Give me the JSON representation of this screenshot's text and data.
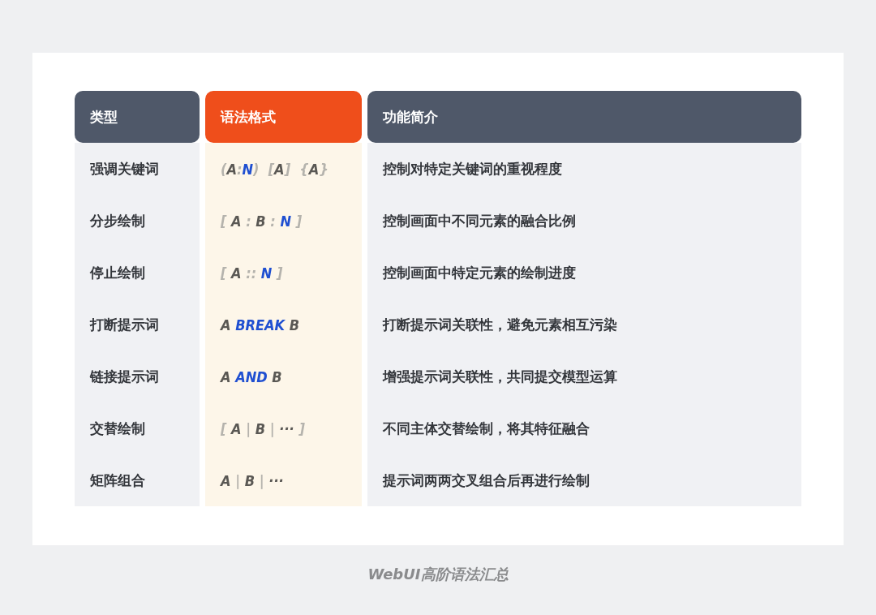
{
  "table": {
    "columns": [
      {
        "label": "类型",
        "kind": "plain"
      },
      {
        "label": "语法格式",
        "kind": "accent"
      },
      {
        "label": "功能简介",
        "kind": "plain"
      }
    ],
    "rows": [
      {
        "type": "强调关键词",
        "syntax": [
          {
            "text": "(",
            "kind": "punct"
          },
          {
            "text": "A",
            "kind": "var"
          },
          {
            "text": ":",
            "kind": "punct"
          },
          {
            "text": "N",
            "kind": "keyword"
          },
          {
            "text": ")  [",
            "kind": "punct"
          },
          {
            "text": "A",
            "kind": "var"
          },
          {
            "text": "]  {",
            "kind": "punct"
          },
          {
            "text": "A",
            "kind": "var"
          },
          {
            "text": "}",
            "kind": "punct"
          }
        ],
        "description": "控制对特定关键词的重视程度"
      },
      {
        "type": "分步绘制",
        "syntax": [
          {
            "text": "[ ",
            "kind": "punct"
          },
          {
            "text": "A",
            "kind": "var"
          },
          {
            "text": " : ",
            "kind": "punct"
          },
          {
            "text": "B",
            "kind": "var"
          },
          {
            "text": " : ",
            "kind": "punct"
          },
          {
            "text": "N",
            "kind": "keyword"
          },
          {
            "text": " ]",
            "kind": "punct"
          }
        ],
        "description": "控制画面中不同元素的融合比例"
      },
      {
        "type": "停止绘制",
        "syntax": [
          {
            "text": "[ ",
            "kind": "punct"
          },
          {
            "text": "A",
            "kind": "var"
          },
          {
            "text": " :: ",
            "kind": "punct"
          },
          {
            "text": "N",
            "kind": "keyword"
          },
          {
            "text": " ]",
            "kind": "punct"
          }
        ],
        "description": "控制画面中特定元素的绘制进度"
      },
      {
        "type": "打断提示词",
        "syntax": [
          {
            "text": "A ",
            "kind": "var"
          },
          {
            "text": "BREAK",
            "kind": "keyword"
          },
          {
            "text": " B",
            "kind": "var"
          }
        ],
        "description": "打断提示词关联性，避免元素相互污染"
      },
      {
        "type": "链接提示词",
        "syntax": [
          {
            "text": "A ",
            "kind": "var"
          },
          {
            "text": "AND",
            "kind": "keyword"
          },
          {
            "text": " B",
            "kind": "var"
          }
        ],
        "description": "增强提示词关联性，共同提交模型运算"
      },
      {
        "type": "交替绘制",
        "syntax": [
          {
            "text": "[ ",
            "kind": "punct"
          },
          {
            "text": "A",
            "kind": "var"
          },
          {
            "text": " | ",
            "kind": "punct"
          },
          {
            "text": "B",
            "kind": "var"
          },
          {
            "text": " | ",
            "kind": "punct"
          },
          {
            "text": "···",
            "kind": "var"
          },
          {
            "text": " ]",
            "kind": "punct"
          }
        ],
        "description": "不同主体交替绘制，将其特征融合"
      },
      {
        "type": "矩阵组合",
        "syntax": [
          {
            "text": "A",
            "kind": "var"
          },
          {
            "text": " | ",
            "kind": "punct"
          },
          {
            "text": "B",
            "kind": "var"
          },
          {
            "text": " | ",
            "kind": "punct"
          },
          {
            "text": "···",
            "kind": "var"
          }
        ],
        "description": "提示词两两交叉组合后再进行绘制"
      }
    ]
  },
  "caption": "WebUI高阶语法汇总"
}
